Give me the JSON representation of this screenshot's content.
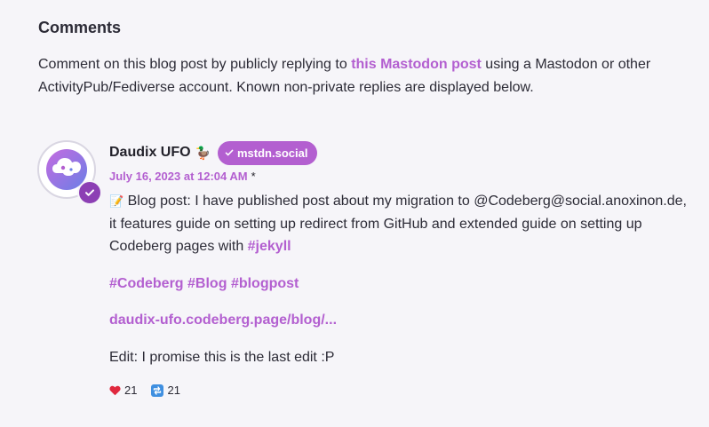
{
  "comments": {
    "heading": "Comments",
    "intro_before": "Comment on this blog post by publicly replying to ",
    "intro_link": "this Mastodon post",
    "intro_after": " using a Mastodon or other ActivityPub/Fediverse account. Known non-private replies are displayed below."
  },
  "comment": {
    "author": "Daudix UFO",
    "author_emoji": "🦆",
    "instance": "mstdn.social",
    "date": "July 16, 2023 at 12:04 AM",
    "edited_marker": "*",
    "text_memo": "📝",
    "text_line": " Blog post: I have published post about my migration to @Codeberg@social.anoxinon.de, it features guide on setting up redirect from GitHub and extended guide on setting up Codeberg pages with ",
    "hashtag_jekyll": "#jekyll",
    "hashtags": [
      "#Codeberg",
      "#Blog",
      "#blogpost"
    ],
    "link": "daudix-ufo.codeberg.page/blog/...",
    "edit_note": "Edit: I promise this is the last edit :P",
    "favourites": "21",
    "boosts": "21"
  },
  "colors": {
    "accent": "#b35fd0",
    "verified": "#8c3fb4",
    "background": "#f6f5f9"
  }
}
